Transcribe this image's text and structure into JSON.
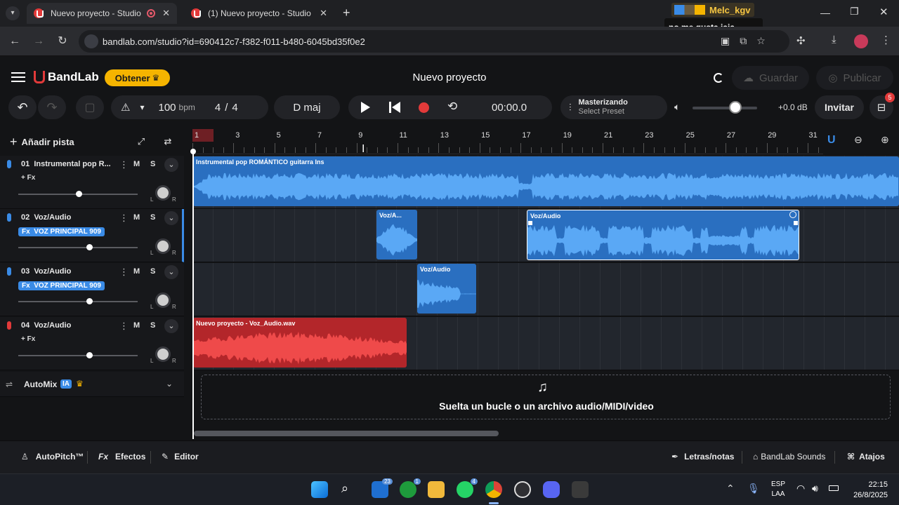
{
  "browser": {
    "tabs": [
      {
        "title": "Nuevo proyecto - Studio",
        "active": true
      },
      {
        "title": "(1) Nuevo proyecto - Studio",
        "active": false
      }
    ],
    "new_tab": "+",
    "url": "bandlab.com/studio?id=690412c7-f382-f011-b480-6045bd35f0e2",
    "overlay_user": "Melc_kgv",
    "overlay_message": "no me gusta jaja"
  },
  "app": {
    "logo": "BandLab",
    "obtener": "Obtener",
    "project_title": "Nuevo proyecto",
    "guardar": "Guardar",
    "publicar": "Publicar",
    "bpm_value": "100",
    "bpm_unit": "bpm",
    "time_sig_num": "4",
    "time_sig_sep": "/",
    "time_sig_den": "4",
    "key": "D maj",
    "time": "00:00.0",
    "mastering_title": "Masterizando",
    "mastering_sub": "Select Preset",
    "volume_db": "+0.0 dB",
    "invitar": "Invitar",
    "gift_badge": "5",
    "add_track": "Añadir pista",
    "ruler": [
      "1",
      "3",
      "5",
      "7",
      "9",
      "11",
      "13",
      "15",
      "17",
      "19",
      "21",
      "23",
      "25",
      "27",
      "29",
      "31"
    ],
    "automix": "AutoMix",
    "automix_badge": "IA",
    "drop_text": "Suelta un bucle o un archivo audio/MIDI/video"
  },
  "tracks": [
    {
      "name": "01  Instrumental pop R...",
      "fx": "+ Fx",
      "fx_active": false,
      "vol": 0.78,
      "color": "#3a8be6"
    },
    {
      "name": "02  Voz/Audio",
      "fx": "Fx  VOZ PRINCIPAL 909",
      "fx_active": true,
      "vol": 0.92,
      "color": "#3a8be6"
    },
    {
      "name": "03  Voz/Audio",
      "fx": "Fx  VOZ PRINCIPAL 909",
      "fx_active": true,
      "vol": 0.92,
      "color": "#3a8be6"
    },
    {
      "name": "04  Voz/Audio",
      "fx": "+ Fx",
      "fx_active": false,
      "vol": 0.92,
      "color": "#e23a3a"
    }
  ],
  "track_labels": {
    "mute": "M",
    "solo": "S",
    "left": "L",
    "right": "R"
  },
  "clips": {
    "c1": "Instrumental pop ROMÁNTICO guitarra  Ins",
    "c2a": "Voz/A...",
    "c2b": "Voz/Audio",
    "c3": "Voz/Audio",
    "c4": "Nuevo proyecto - Voz_Audio.wav"
  },
  "bottom": {
    "autopitch": "AutoPitch™",
    "efectos": "Efectos",
    "editor": "Editor",
    "letras": "Letras/notas",
    "sounds": "BandLab Sounds",
    "atajos": "Atajos"
  },
  "taskbar": {
    "lang1": "ESP",
    "lang2": "LAA",
    "time": "22:15",
    "date": "26/8/2025",
    "badges": [
      "23",
      "1",
      "4"
    ]
  },
  "colors": {
    "accent": "#3a8be6",
    "rec": "#e23a3a",
    "gold": "#f5b400"
  }
}
